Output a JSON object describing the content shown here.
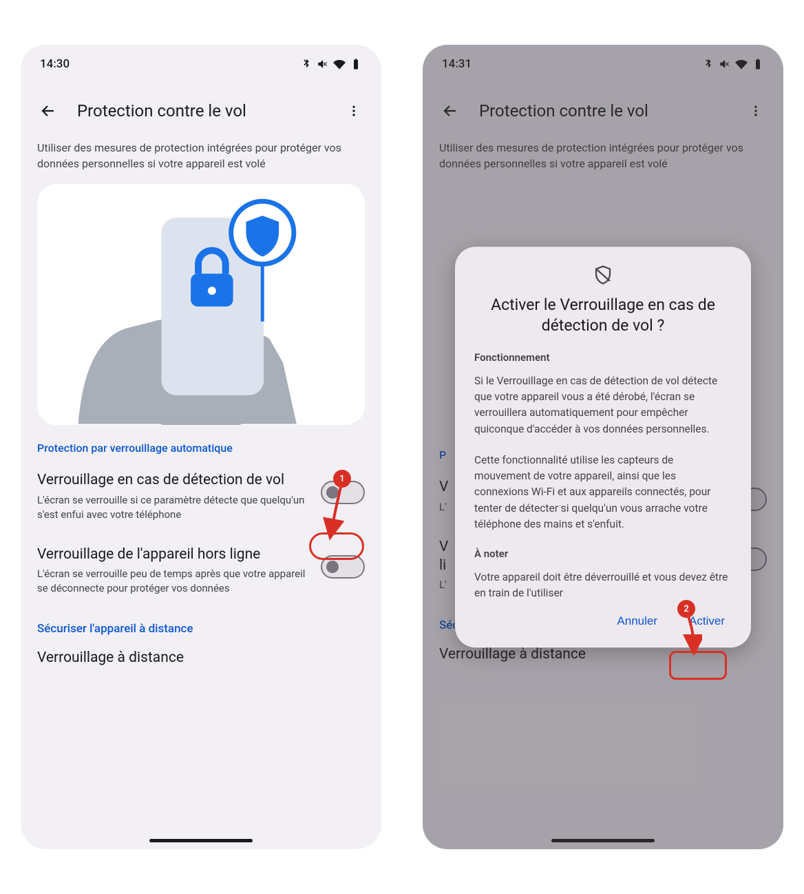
{
  "left": {
    "status_time": "14:30",
    "page_title": "Protection contre le vol",
    "subtitle": "Utiliser des mesures de protection intégrées pour protéger vos données personnelles si votre appareil est volé",
    "section_auto_lock": "Protection par verrouillage automatique",
    "setting1_title": "Verrouillage en cas de détection de vol",
    "setting1_desc": "L'écran se verrouille si ce paramètre détecte que quelqu'un s'est enfui avec votre téléphone",
    "setting2_title": "Verrouillage de l'appareil hors ligne",
    "setting2_desc": "L'écran se verrouille peu de temps après que votre appareil se déconnecte pour protéger vos données",
    "link_remote": "Sécuriser l'appareil à distance",
    "setting3_title": "Verrouillage à distance"
  },
  "right": {
    "status_time": "14:31",
    "page_title": "Protection contre le vol",
    "subtitle": "Utiliser des mesures de protection intégrées pour protéger vos données personnelles si votre appareil est volé",
    "dialog_title": "Activer le Verrouillage en cas de détection de vol ?",
    "dialog_sub1": "Fonctionnement",
    "dialog_p1": "Si le Verrouillage en cas de détection de vol détecte que votre appareil vous a été dérobé, l'écran se verrouillera automatiquement pour empêcher quiconque d'accéder à vos données personnelles.",
    "dialog_p2": "Cette fonctionnalité utilise les capteurs de mouvement de votre appareil, ainsi que les connexions Wi-Fi et aux appareils connectés, pour tenter de détecter si quelqu'un vous arrache votre téléphone des mains et s'enfuit.",
    "dialog_sub2": "À noter",
    "dialog_p3": "Votre appareil doit être déverrouillé et vous devez être en train de l'utiliser",
    "btn_cancel": "Annuler",
    "btn_activate": "Activer",
    "link_remote": "Sécuriser l'appareil à distance",
    "setting3_title": "Verrouillage à distance",
    "section_auto_lock": "P",
    "s1_title_partial": "V",
    "s1_desc_partial": "L'",
    "s2_title_partial1": "V",
    "s2_title_partial2": "li",
    "s2_desc_partial": "L'"
  },
  "annotations": {
    "badge1": "1",
    "badge2": "2"
  }
}
